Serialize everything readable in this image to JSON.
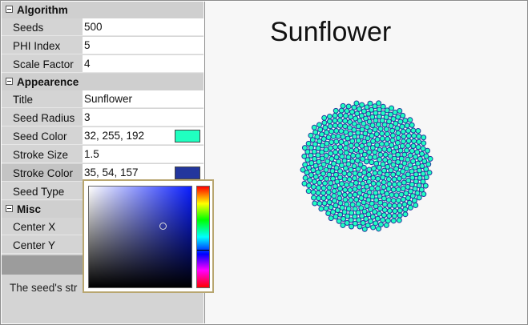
{
  "categories": {
    "algorithm": "Algorithm",
    "appearence": "Appearence",
    "misc": "Misc"
  },
  "properties": {
    "seeds": {
      "label": "Seeds",
      "value": "500"
    },
    "phi_index": {
      "label": "PHI Index",
      "value": "5"
    },
    "scale_factor": {
      "label": "Scale Factor",
      "value": "4"
    },
    "title": {
      "label": "Title",
      "value": "Sunflower"
    },
    "seed_radius": {
      "label": "Seed Radius",
      "value": "3"
    },
    "seed_color": {
      "label": "Seed Color",
      "value": "32, 255, 192",
      "swatch": "#20ffc0"
    },
    "stroke_size": {
      "label": "Stroke Size",
      "value": "1.5"
    },
    "stroke_color": {
      "label": "Stroke Color",
      "value": "35, 54, 157",
      "swatch": "#23369d"
    },
    "seed_type": {
      "label": "Seed Type"
    },
    "center_x": {
      "label": "Center X"
    },
    "center_y": {
      "label": "Center Y"
    }
  },
  "description": "The seed's str",
  "canvas": {
    "title": "Sunflower",
    "seed_fill": "#20ffc0",
    "seed_stroke": "#23369d",
    "seed_count": 500
  },
  "picker": {
    "selected_color": "#23369d"
  }
}
